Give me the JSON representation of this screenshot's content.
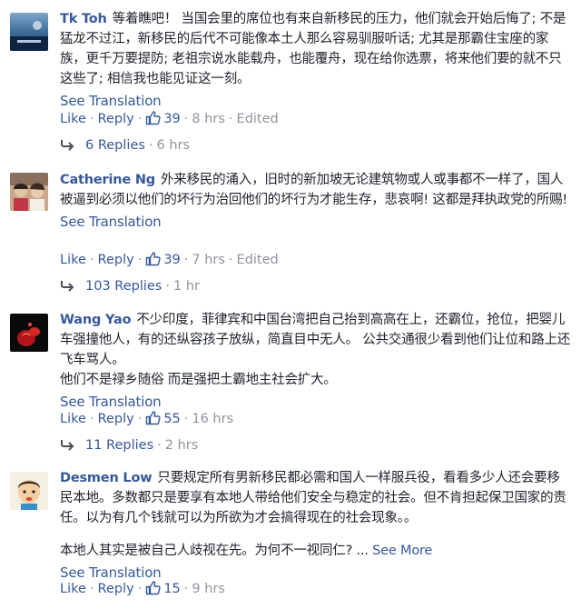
{
  "see_translation_label": "See Translation",
  "like_label": "Like",
  "reply_label": "Reply",
  "separator": "·",
  "comments": [
    {
      "author": "Tk Toh",
      "text": "等着瞧吧！ 当国会里的席位也有来自新移民的压力，他们就会开始后悔了; 不是猛龙不过江，新移民的后代不可能像本土人那么容易驯服听话; 尤其是那霸住宝座的家族，更千万要提防; 老祖宗说水能载舟，也能覆舟，现在给你选票，将来他们要的就不只这些了; 相信我也能见证这一刻。",
      "likes": "39",
      "time": "8 hrs",
      "edited": "Edited",
      "replies_label": "6 Replies",
      "replies_time": "6 hrs"
    },
    {
      "author": "Catherine Ng",
      "text": "外来移民的涌入，旧时的新加坡无论建筑物或人或事都不一样了，国人被逼到必须以他们的坏行为治回他们的坏行为才能生存，悲哀啊! 这都是拜执政党的所赐!",
      "likes": "39",
      "time": "7 hrs",
      "edited": "Edited",
      "replies_label": "103 Replies",
      "replies_time": "1 hr"
    },
    {
      "author": "Wang Yao",
      "text": "不少印度，菲律宾和中国台湾把自己抬到高高在上，还霸位，抢位，把婴儿车强撞他人，有的还纵容孩子放纵，简直目中无人。 公共交通很少看到他们让位和路上还飞车骂人。",
      "text2": "他们不是禄乡随俗 而是强把土霸地主社会扩大。",
      "likes": "55",
      "time": "16 hrs",
      "replies_label": "11 Replies",
      "replies_time": "2 hrs"
    },
    {
      "author": "Desmen Low",
      "text": "只要规定所有男新移民都必需和国人一样服兵役，看看多少人还会要移民本地。多数都只是要享有本地人带给他们安全与稳定的社会。但不肯担起保卫国家的责任。以为有几个钱就可以为所欲为才会搞得现在的社会现象。。",
      "text2": "本地人其实是被自己人歧视在先。为何不一视同仁? ...",
      "see_more": "See More",
      "likes": "15",
      "time": "9 hrs"
    }
  ]
}
